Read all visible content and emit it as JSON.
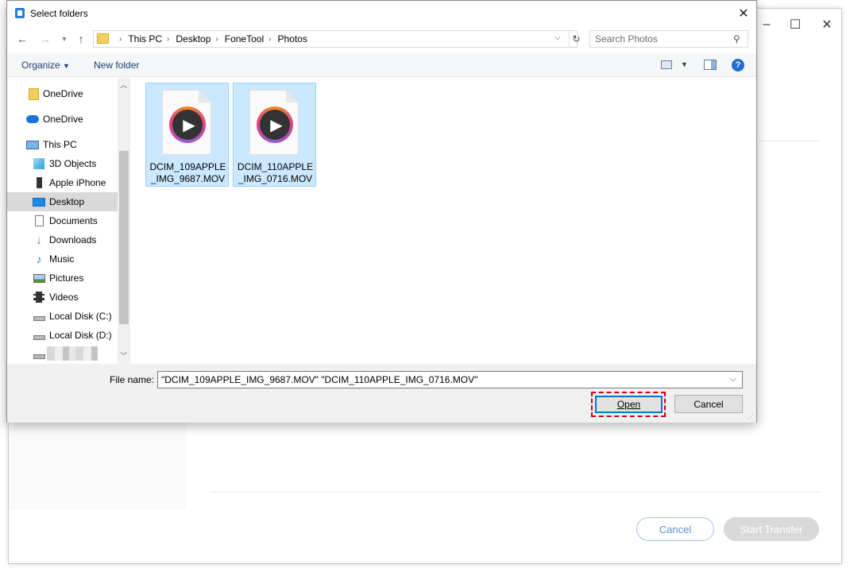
{
  "background_app": {
    "cancel_label": "Cancel",
    "start_label": "Start Transfer",
    "minimize_icon": "minimize-icon",
    "maximize_icon": "maximize-icon",
    "close_icon": "close-icon"
  },
  "dialog": {
    "title": "Select folders",
    "address": {
      "crumbs": [
        "This PC",
        "Desktop",
        "FoneTool",
        "Photos"
      ]
    },
    "search": {
      "placeholder": "Search Photos"
    },
    "toolbar": {
      "organize_label": "Organize",
      "new_folder_label": "New folder",
      "help_label": "?"
    },
    "nav_items": [
      {
        "label": "OneDrive",
        "icon": "folder-icon",
        "selected": false
      },
      {
        "label": "OneDrive",
        "icon": "cloud-icon",
        "selected": false
      },
      {
        "label": "This PC",
        "icon": "computer-icon",
        "selected": false
      },
      {
        "label": "3D Objects",
        "icon": "cube-icon",
        "selected": false
      },
      {
        "label": "Apple iPhone",
        "icon": "phone-icon",
        "selected": false
      },
      {
        "label": "Desktop",
        "icon": "desktop-icon",
        "selected": true
      },
      {
        "label": "Documents",
        "icon": "document-icon",
        "selected": false
      },
      {
        "label": "Downloads",
        "icon": "download-icon",
        "selected": false
      },
      {
        "label": "Music",
        "icon": "music-icon",
        "selected": false
      },
      {
        "label": "Pictures",
        "icon": "picture-icon",
        "selected": false
      },
      {
        "label": "Videos",
        "icon": "video-icon",
        "selected": false
      },
      {
        "label": "Local Disk (C:)",
        "icon": "drive-icon",
        "selected": false
      },
      {
        "label": "Local Disk (D:)",
        "icon": "drive-icon",
        "selected": false
      }
    ],
    "files": [
      {
        "name": "DCIM_109APPLE_IMG_9687.MOV",
        "selected": true
      },
      {
        "name": "DCIM_110APPLE_IMG_0716.MOV",
        "selected": true
      }
    ],
    "file_name_label": "File name:",
    "file_name_value": "\"DCIM_109APPLE_IMG_9687.MOV\" \"DCIM_110APPLE_IMG_0716.MOV\"",
    "open_label": "Open",
    "cancel_label": "Cancel"
  },
  "colors": {
    "selection": "#cce8ff",
    "accent": "#0078d7",
    "highlight": "#d0021b"
  }
}
